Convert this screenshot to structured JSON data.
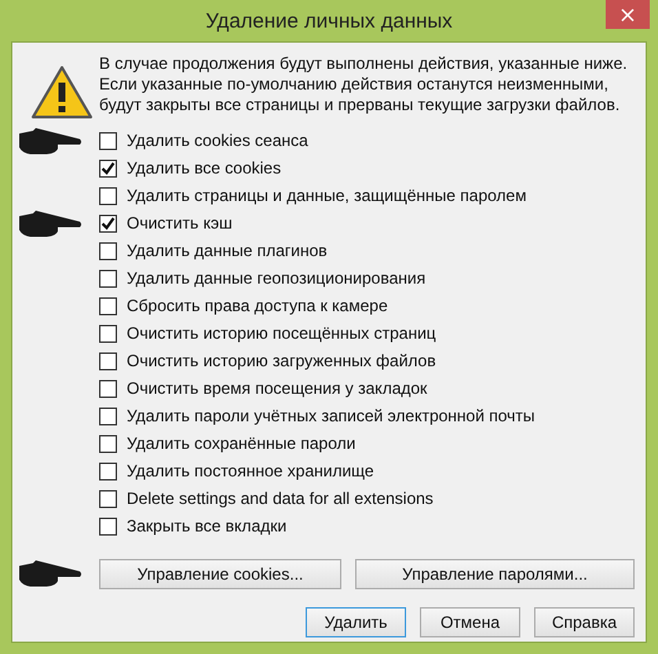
{
  "window": {
    "title": "Удаление личных данных",
    "close": "×"
  },
  "message": "В случае продолжения будут выполнены действия, указанные ниже. Если указанные по-умолчанию действия останутся неизменными, будут закрыты все страницы и прерваны текущие загрузки файлов.",
  "options": [
    {
      "label": "Удалить cookies сеанса",
      "checked": false,
      "pointer": true
    },
    {
      "label": "Удалить все cookies",
      "checked": true,
      "pointer": false
    },
    {
      "label": "Удалить страницы и данные, защищённые паролем",
      "checked": false,
      "pointer": false
    },
    {
      "label": "Очистить кэш",
      "checked": true,
      "pointer": true
    },
    {
      "label": "Удалить данные плагинов",
      "checked": false,
      "pointer": false
    },
    {
      "label": "Удалить данные геопозиционирования",
      "checked": false,
      "pointer": false
    },
    {
      "label": "Сбросить права доступа к камере",
      "checked": false,
      "pointer": false
    },
    {
      "label": "Очистить историю посещённых страниц",
      "checked": false,
      "pointer": false
    },
    {
      "label": "Очистить историю загруженных файлов",
      "checked": false,
      "pointer": false
    },
    {
      "label": "Очистить время посещения у закладок",
      "checked": false,
      "pointer": false
    },
    {
      "label": "Удалить пароли учётных записей электронной почты",
      "checked": false,
      "pointer": false
    },
    {
      "label": "Удалить сохранённые пароли",
      "checked": false,
      "pointer": false
    },
    {
      "label": "Удалить постоянное хранилище",
      "checked": false,
      "pointer": false
    },
    {
      "label": "Delete settings and data for all extensions",
      "checked": false,
      "pointer": false
    },
    {
      "label": "Закрыть все вкладки",
      "checked": false,
      "pointer": false
    }
  ],
  "manage_buttons": [
    {
      "label": "Управление cookies...",
      "pointer": true
    },
    {
      "label": "Управление паролями...",
      "pointer": false
    }
  ],
  "buttons": [
    {
      "label": "Удалить",
      "selected": true
    },
    {
      "label": "Отмена",
      "selected": false
    },
    {
      "label": "Справка",
      "selected": false
    }
  ]
}
